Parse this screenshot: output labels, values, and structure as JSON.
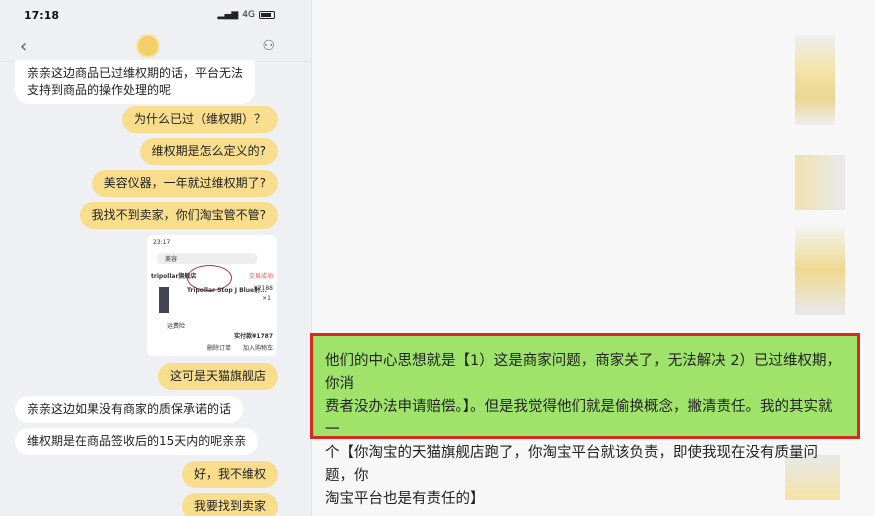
{
  "status": {
    "time": "17:18",
    "network": "4G"
  },
  "chat": [
    {
      "side": "received",
      "text_lines": [
        "亲亲这边商品已过维权期的话，平台无法",
        "支持到商品的操作处理的呢"
      ]
    },
    {
      "side": "sent",
      "text": "为什么已过（维权期）？"
    },
    {
      "side": "sent",
      "text": "维权期是怎么定义的?"
    },
    {
      "side": "sent",
      "text": "美容仪器，一年就过维权期了?"
    },
    {
      "side": "sent",
      "text": "我找不到卖家，你们淘宝管不管?"
    },
    {
      "side": "sent",
      "text": "这可是天猫旗舰店"
    },
    {
      "side": "received",
      "text": "亲亲这边如果没有商家的质保承诺的话"
    },
    {
      "side": "received",
      "text": "维权期是在商品签收后的15天内的呢亲亲"
    },
    {
      "side": "sent",
      "text": "好，我不维权"
    },
    {
      "side": "sent",
      "text": "我要找到卖家"
    }
  ],
  "embedded_order": {
    "time": "23:17",
    "search": "美容",
    "store": "tripollar旗舰店",
    "status": "交易成功",
    "product": "Tripollar Stop J Blue射...",
    "price": "¥2188",
    "qty": "×1",
    "paid": "实付款¥1787",
    "delete_btn": "删除订单",
    "cart_btn": "加入购物车",
    "freight": "运费险"
  },
  "annotation": {
    "text_lines": [
      "他们的中心思想就是【1）这是商家问题，商家关了，无法解决  2）已过维权期，你消",
      "费者没办法申请赔偿。】。但是我觉得他们就是偷换概念，撇清责任。我的其实就一",
      "个【你淘宝的天猫旗舰店跑了，你淘宝平台就该负责，即使我现在没有质量问题，你",
      "淘宝平台也是有责任的】"
    ]
  },
  "colors": {
    "sent": "#f7dd8c",
    "annotation_bg": "#9fe36b",
    "annotation_border": "#d92a22"
  }
}
